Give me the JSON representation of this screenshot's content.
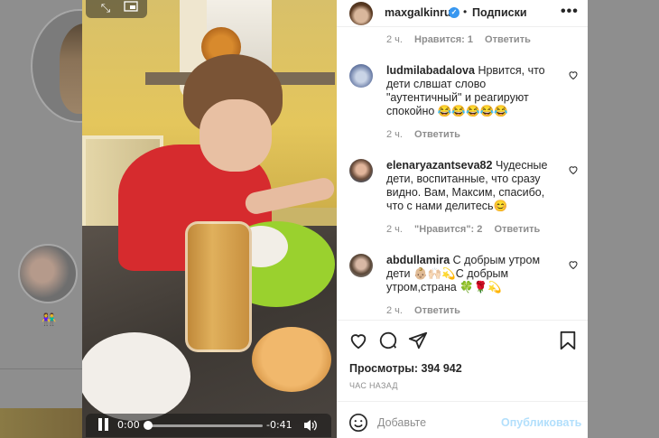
{
  "post": {
    "username": "maxgalkinru",
    "follow_label": "Подписки",
    "separator": "•",
    "views_label": "Просмотры: 394 942",
    "time_ago": "ЧАС НАЗАД",
    "add_comment_placeholder": "Добавьте",
    "publish_label": "Опубликовать"
  },
  "video": {
    "current_time": "0:00",
    "remaining_time": "-0:41",
    "progress_fraction": 0.0
  },
  "top_meta": {
    "time": "2 ч.",
    "likes": "Нравится: 1",
    "reply": "Ответить"
  },
  "comments": [
    {
      "username": "ludmilabadalova",
      "text": "Нрвится, что дети слвшат слово \"аутентичный\" и реагируют спокойно 😂😂😂😂😂",
      "time": "2 ч.",
      "likes": "",
      "reply": "Ответить"
    },
    {
      "username": "elenaryazantseva82",
      "text": "Чудесные дети, воспитанные, что сразу видно. Вам, Максим, спасибо, что с нами делитесь😊",
      "time": "2 ч.",
      "likes": "\"Нравится\": 2",
      "reply": "Ответить"
    },
    {
      "username": "abdullamira",
      "text": "С добрым утром дети 👶🏼🙌🏻💫С добрым утром,страна 🍀🌹💫",
      "time": "2 ч.",
      "likes": "",
      "reply": "Ответить"
    }
  ],
  "icons": {
    "heart": "heart-icon",
    "comment": "comment-icon",
    "share": "share-icon",
    "bookmark": "bookmark-icon",
    "emoji": "emoji-icon",
    "more": "more-icon"
  },
  "colors": {
    "verified": "#3897f0",
    "publish_disabled": "#b2dffc",
    "meta_gray": "#8e8e8e"
  }
}
